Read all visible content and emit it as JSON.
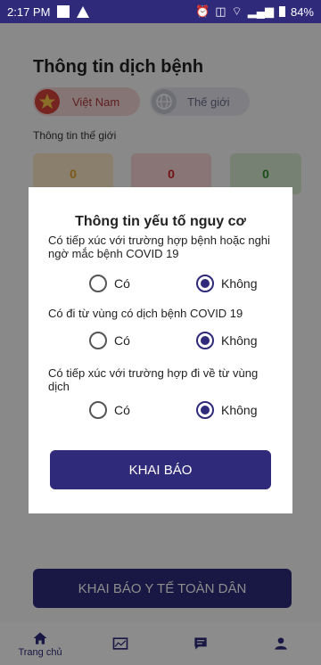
{
  "status_bar": {
    "time": "2:17 PM",
    "battery": "84%"
  },
  "page": {
    "title": "Thông tin dịch bệnh",
    "chips": {
      "vietnam": "Việt Nam",
      "world": "Thế giới"
    },
    "subtitle": "Thông tin thế giới",
    "stats": [
      "0",
      "0",
      "0"
    ],
    "cta_label": "KHAI BÁO Y TẾ TOÀN DÂN"
  },
  "nav": {
    "home_label": "Trang chủ"
  },
  "dialog": {
    "title": "Thông tin yếu tố nguy cơ",
    "questions": [
      {
        "text": "Có tiếp xúc với trường hợp bệnh hoặc nghi ngờ mắc bệnh COVID 19",
        "yes": "Có",
        "no": "Không",
        "selected": "no"
      },
      {
        "text": "Có đi từ vùng có dịch bệnh COVID 19",
        "yes": "Có",
        "no": "Không",
        "selected": "no"
      },
      {
        "text": "Có tiếp xúc với trường hợp đi về từ vùng dịch",
        "yes": "Có",
        "no": "Không",
        "selected": "no"
      }
    ],
    "submit_label": "KHAI BÁO"
  },
  "colors": {
    "primary": "#2f2a7a"
  },
  "icons": {
    "home": "home-icon",
    "stats": "stats-icon",
    "chat": "chat-icon",
    "profile": "person-icon"
  }
}
